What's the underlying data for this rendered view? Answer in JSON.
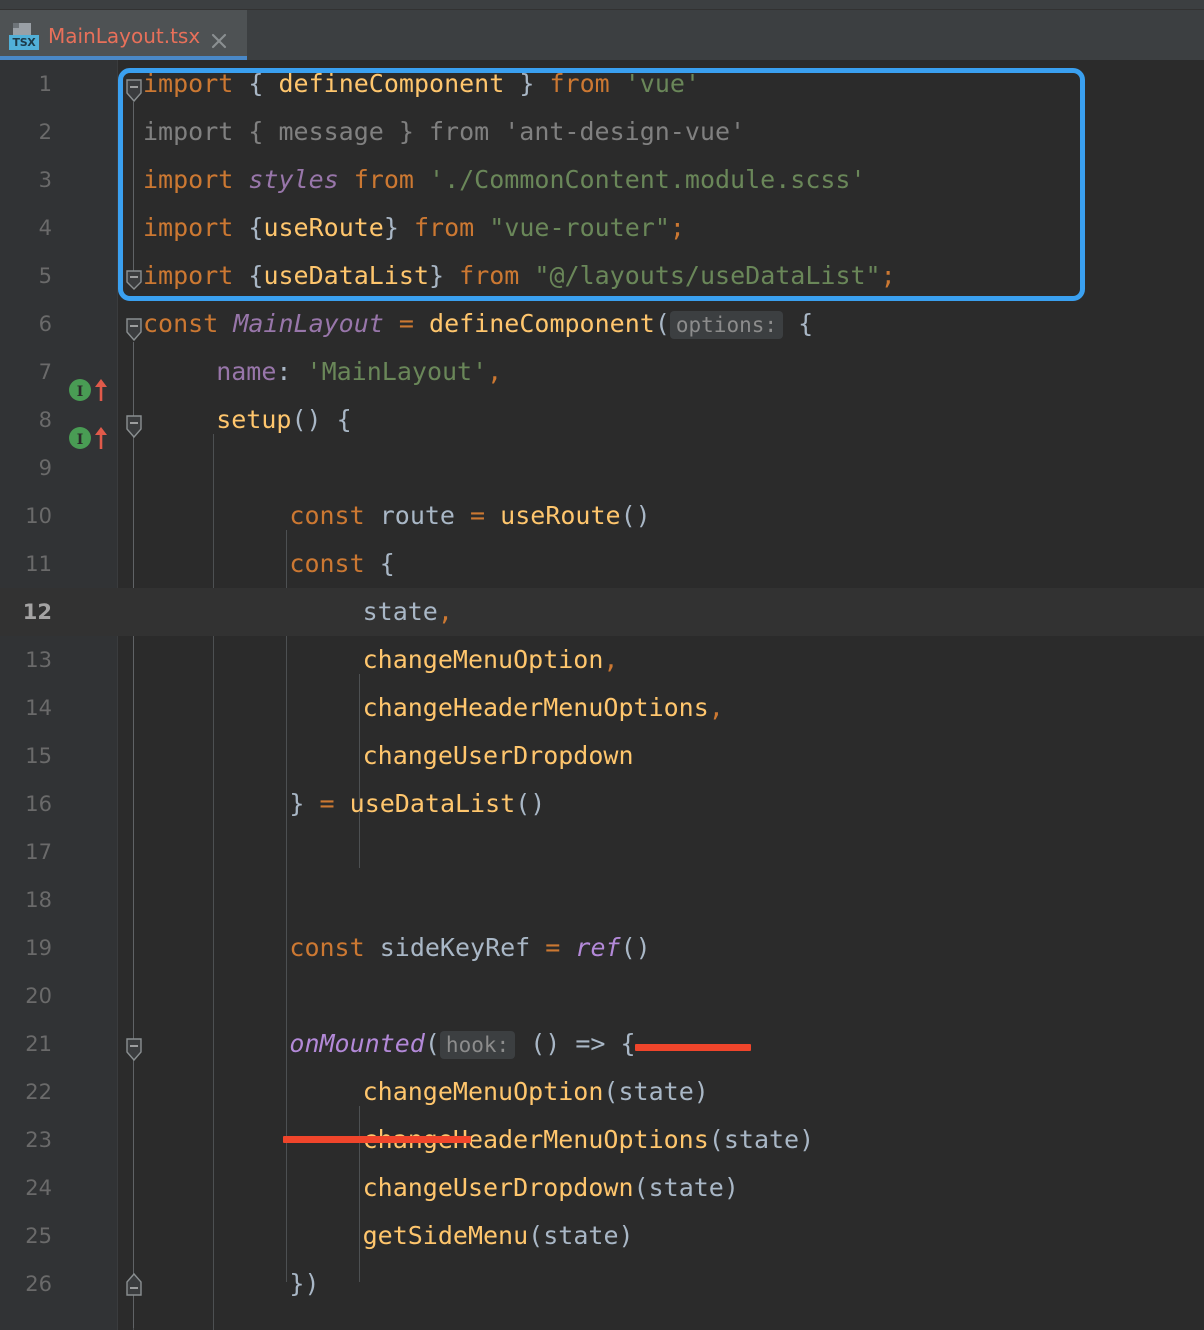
{
  "window": {
    "theme": "darcula",
    "accent_color": "#3aa0f0",
    "editor_background": "#2b2b2b",
    "gutter_background": "#313335",
    "tabbar_background": "#3c3f41"
  },
  "tabbar": {
    "tabs": [
      {
        "label": "MainLayout.tsx",
        "icon": "tsx-file-icon",
        "badge": "TSX",
        "active": true,
        "close_icon": "close-icon",
        "title_color": "#e8705a"
      }
    ]
  },
  "editor": {
    "caret_line": 12,
    "first_visible_line": 1,
    "last_visible_line": 26,
    "lines": [
      {
        "n": "1",
        "marker": null,
        "fold": "start"
      },
      {
        "n": "2",
        "marker": null,
        "fold": null
      },
      {
        "n": "3",
        "marker": null,
        "fold": null
      },
      {
        "n": "4",
        "marker": null,
        "fold": null
      },
      {
        "n": "5",
        "marker": null,
        "fold": "end"
      },
      {
        "n": "6",
        "marker": null,
        "fold": "start"
      },
      {
        "n": "7",
        "marker": "implemented-up",
        "fold": null
      },
      {
        "n": "8",
        "marker": "implemented-up",
        "fold": "start"
      },
      {
        "n": "9",
        "marker": null,
        "fold": null
      },
      {
        "n": "10",
        "marker": null,
        "fold": null
      },
      {
        "n": "11",
        "marker": null,
        "fold": null
      },
      {
        "n": "12",
        "marker": null,
        "fold": null
      },
      {
        "n": "13",
        "marker": null,
        "fold": null
      },
      {
        "n": "14",
        "marker": null,
        "fold": null
      },
      {
        "n": "15",
        "marker": null,
        "fold": null
      },
      {
        "n": "16",
        "marker": null,
        "fold": null
      },
      {
        "n": "17",
        "marker": null,
        "fold": null
      },
      {
        "n": "18",
        "marker": null,
        "fold": null
      },
      {
        "n": "19",
        "marker": null,
        "fold": null
      },
      {
        "n": "20",
        "marker": null,
        "fold": null
      },
      {
        "n": "21",
        "marker": null,
        "fold": "start"
      },
      {
        "n": "22",
        "marker": null,
        "fold": null
      },
      {
        "n": "23",
        "marker": null,
        "fold": null
      },
      {
        "n": "24",
        "marker": null,
        "fold": null
      },
      {
        "n": "25",
        "marker": null,
        "fold": null
      },
      {
        "n": "26",
        "marker": null,
        "fold": "end"
      }
    ],
    "code_text": {
      "l1": "import { defineComponent } from 'vue'",
      "l2": "import { message } from 'ant-design-vue'",
      "l3": "import styles from './CommonContent.module.scss'",
      "l4": "import {useRoute} from \"vue-router\";",
      "l5": "import {useDataList} from \"@/layouts/useDataList\";",
      "l6": "const MainLayout = defineComponent( options: {",
      "l7": "    name: 'MainLayout',",
      "l8": "    setup() {",
      "l9": "",
      "l10": "        const route = useRoute()",
      "l11": "        const {",
      "l12": "            state,",
      "l13": "            changeMenuOption,",
      "l14": "            changeHeaderMenuOptions,",
      "l15": "            changeUserDropdown",
      "l16": "        } = useDataList()",
      "l17": "",
      "l18": "",
      "l19": "        const sideKeyRef = ref()",
      "l20": "",
      "l21": "        onMounted( hook: () => {",
      "l22": "            changeMenuOption(state)",
      "l23": "            changeHeaderMenuOptions(state)",
      "l24": "            changeUserDropdown(state)",
      "l25": "            getSideMenu(state)",
      "l26": "        })"
    },
    "inlay_hints": [
      {
        "line": 6,
        "text": "options:"
      },
      {
        "line": 21,
        "text": "hook:"
      }
    ],
    "annotations": {
      "blue_box": {
        "shape": "rounded-rectangle",
        "color": "#3aa0f0",
        "covers_lines": "1-5"
      },
      "red_underlines": [
        {
          "target": "ref()",
          "line": 19,
          "color": "#f0452b"
        },
        {
          "target": "onMounted",
          "line": 21,
          "color": "#f0452b"
        }
      ]
    },
    "tokens": {
      "l1": [
        [
          "kw",
          "import"
        ],
        [
          "plain",
          " "
        ],
        [
          "punc",
          "{"
        ],
        [
          "plain",
          " "
        ],
        [
          "ident",
          "defineComponent"
        ],
        [
          "plain",
          " "
        ],
        [
          "punc",
          "}"
        ],
        [
          "plain",
          " "
        ],
        [
          "kw",
          "from"
        ],
        [
          "plain",
          " "
        ],
        [
          "str",
          "'vue'"
        ]
      ],
      "l2": [
        [
          "dim",
          "import { message } from 'ant-design-vue'"
        ]
      ],
      "l3": [
        [
          "kw",
          "import"
        ],
        [
          "plain",
          " "
        ],
        [
          "italic-v",
          "styles"
        ],
        [
          "plain",
          " "
        ],
        [
          "kw",
          "from"
        ],
        [
          "plain",
          " "
        ],
        [
          "str",
          "'./CommonContent.module.scss'"
        ]
      ],
      "l4": [
        [
          "kw",
          "import"
        ],
        [
          "plain",
          " "
        ],
        [
          "punc",
          "{"
        ],
        [
          "ident",
          "useRoute"
        ],
        [
          "punc",
          "}"
        ],
        [
          "plain",
          " "
        ],
        [
          "kw",
          "from"
        ],
        [
          "plain",
          " "
        ],
        [
          "str",
          "\"vue-router\""
        ],
        [
          "kw",
          ";"
        ]
      ],
      "l5": [
        [
          "kw",
          "import"
        ],
        [
          "plain",
          " "
        ],
        [
          "punc",
          "{"
        ],
        [
          "ident",
          "useDataList"
        ],
        [
          "punc",
          "}"
        ],
        [
          "plain",
          " "
        ],
        [
          "kw",
          "from"
        ],
        [
          "plain",
          " "
        ],
        [
          "str",
          "\"@/layouts/useDataList\""
        ],
        [
          "kw",
          ";"
        ]
      ],
      "l6": [
        [
          "kw",
          "const"
        ],
        [
          "plain",
          " "
        ],
        [
          "italic-v",
          "MainLayout"
        ],
        [
          "plain",
          " "
        ],
        [
          "kw",
          "="
        ],
        [
          "plain",
          " "
        ],
        [
          "ident",
          "defineComponent"
        ],
        [
          "punc",
          "("
        ],
        [
          "hint",
          "options:"
        ],
        [
          "punc",
          " {"
        ]
      ],
      "l7": [
        [
          "prop",
          "name"
        ],
        [
          "punc",
          ":"
        ],
        [
          "plain",
          " "
        ],
        [
          "str",
          "'MainLayout'"
        ],
        [
          "kw",
          ","
        ]
      ],
      "l8": [
        [
          "ident",
          "setup"
        ],
        [
          "punc",
          "() {"
        ]
      ],
      "l10": [
        [
          "kw",
          "const"
        ],
        [
          "plain",
          " "
        ],
        [
          "plain",
          "route"
        ],
        [
          "plain",
          " "
        ],
        [
          "kw",
          "="
        ],
        [
          "plain",
          " "
        ],
        [
          "ident",
          "useRoute"
        ],
        [
          "punc",
          "()"
        ]
      ],
      "l11": [
        [
          "kw",
          "const"
        ],
        [
          "plain",
          " "
        ],
        [
          "punc",
          "{"
        ]
      ],
      "l12": [
        [
          "plain",
          "state"
        ],
        [
          "kw",
          ","
        ]
      ],
      "l13": [
        [
          "ident",
          "changeMenuOption"
        ],
        [
          "kw",
          ","
        ]
      ],
      "l14": [
        [
          "ident",
          "changeHeaderMenuOptions"
        ],
        [
          "kw",
          ","
        ]
      ],
      "l15": [
        [
          "ident",
          "changeUserDropdown"
        ]
      ],
      "l16": [
        [
          "punc",
          "}"
        ],
        [
          "plain",
          " "
        ],
        [
          "kw",
          "="
        ],
        [
          "plain",
          " "
        ],
        [
          "ident",
          "useDataList"
        ],
        [
          "punc",
          "()"
        ]
      ],
      "l19": [
        [
          "kw",
          "const"
        ],
        [
          "plain",
          " "
        ],
        [
          "plain",
          "sideKeyRef"
        ],
        [
          "plain",
          " "
        ],
        [
          "kw",
          "="
        ],
        [
          "plain",
          " "
        ],
        [
          "italic-c",
          "ref"
        ],
        [
          "punc",
          "()"
        ]
      ],
      "l21": [
        [
          "italic-c",
          "onMounted"
        ],
        [
          "punc",
          "("
        ],
        [
          "hint",
          "hook:"
        ],
        [
          "punc",
          " () => {"
        ]
      ],
      "l22": [
        [
          "ident",
          "changeMenuOption"
        ],
        [
          "punc",
          "("
        ],
        [
          "plain",
          "state"
        ],
        [
          "punc",
          ")"
        ]
      ],
      "l23": [
        [
          "ident",
          "changeHeaderMenuOptions"
        ],
        [
          "punc",
          "("
        ],
        [
          "plain",
          "state"
        ],
        [
          "punc",
          ")"
        ]
      ],
      "l24": [
        [
          "ident",
          "changeUserDropdown"
        ],
        [
          "punc",
          "("
        ],
        [
          "plain",
          "state"
        ],
        [
          "punc",
          ")"
        ]
      ],
      "l25": [
        [
          "ident",
          "getSideMenu"
        ],
        [
          "punc",
          "("
        ],
        [
          "plain",
          "state"
        ],
        [
          "punc",
          ")"
        ]
      ],
      "l26": [
        [
          "punc",
          "})"
        ]
      ]
    }
  }
}
